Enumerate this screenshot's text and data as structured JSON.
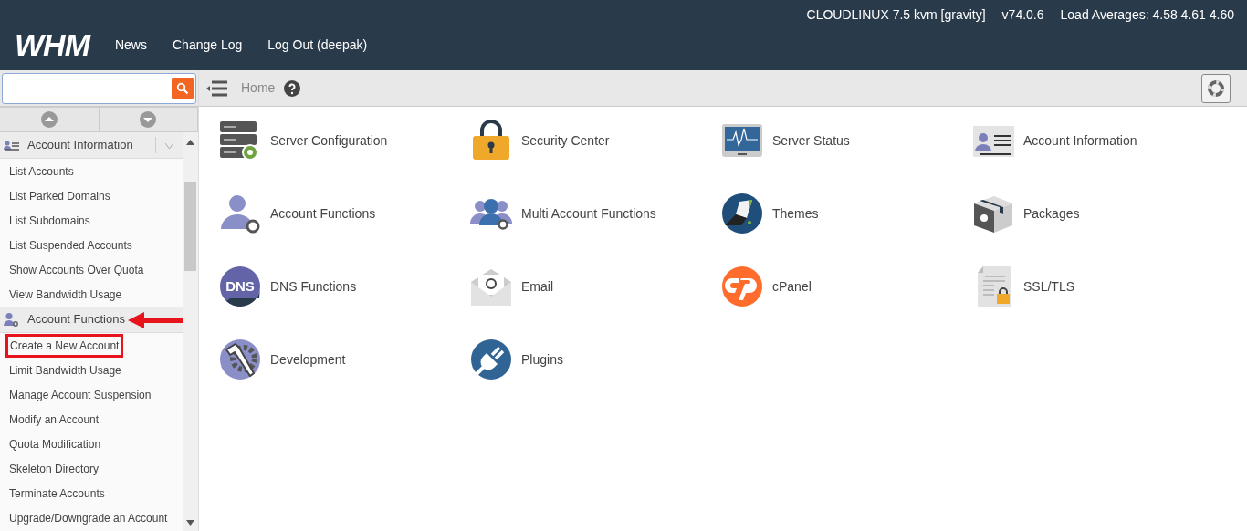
{
  "header": {
    "logo": "WHM",
    "nav": [
      "News",
      "Change Log",
      "Log Out (deepak)"
    ],
    "server_info": [
      "CLOUDLINUX 7.5 kvm [gravity]",
      "v74.0.6",
      "Load Averages: 4.58 4.61 4.60"
    ]
  },
  "breadcrumb": {
    "label": "Home"
  },
  "sidebar": {
    "sections": [
      {
        "title": "Account Information",
        "expanded": true,
        "callout": false,
        "items": [
          {
            "label": "List Accounts",
            "highlighted": false
          },
          {
            "label": "List Parked Domains",
            "highlighted": false
          },
          {
            "label": "List Subdomains",
            "highlighted": false
          },
          {
            "label": "List Suspended Accounts",
            "highlighted": false
          },
          {
            "label": "Show Accounts Over Quota",
            "highlighted": false
          },
          {
            "label": "View Bandwidth Usage",
            "highlighted": false
          }
        ]
      },
      {
        "title": "Account Functions",
        "expanded": true,
        "callout": true,
        "items": [
          {
            "label": "Create a New Account",
            "highlighted": true
          },
          {
            "label": "Limit Bandwidth Usage",
            "highlighted": false
          },
          {
            "label": "Manage Account Suspension",
            "highlighted": false
          },
          {
            "label": "Modify an Account",
            "highlighted": false
          },
          {
            "label": "Quota Modification",
            "highlighted": false
          },
          {
            "label": "Skeleton Directory",
            "highlighted": false
          },
          {
            "label": "Terminate Accounts",
            "highlighted": false
          },
          {
            "label": "Upgrade/Downgrade an Account",
            "highlighted": false
          }
        ]
      }
    ]
  },
  "groups": [
    {
      "label": "Server Configuration"
    },
    {
      "label": "Security Center"
    },
    {
      "label": "Server Status"
    },
    {
      "label": "Account Information"
    },
    {
      "label": "Account Functions"
    },
    {
      "label": "Multi Account Functions"
    },
    {
      "label": "Themes"
    },
    {
      "label": "Packages"
    },
    {
      "label": "DNS Functions",
      "icon_text": "DNS"
    },
    {
      "label": "Email"
    },
    {
      "label": "cPanel"
    },
    {
      "label": "SSL/TLS"
    },
    {
      "label": "Development"
    },
    {
      "label": "Plugins"
    }
  ]
}
